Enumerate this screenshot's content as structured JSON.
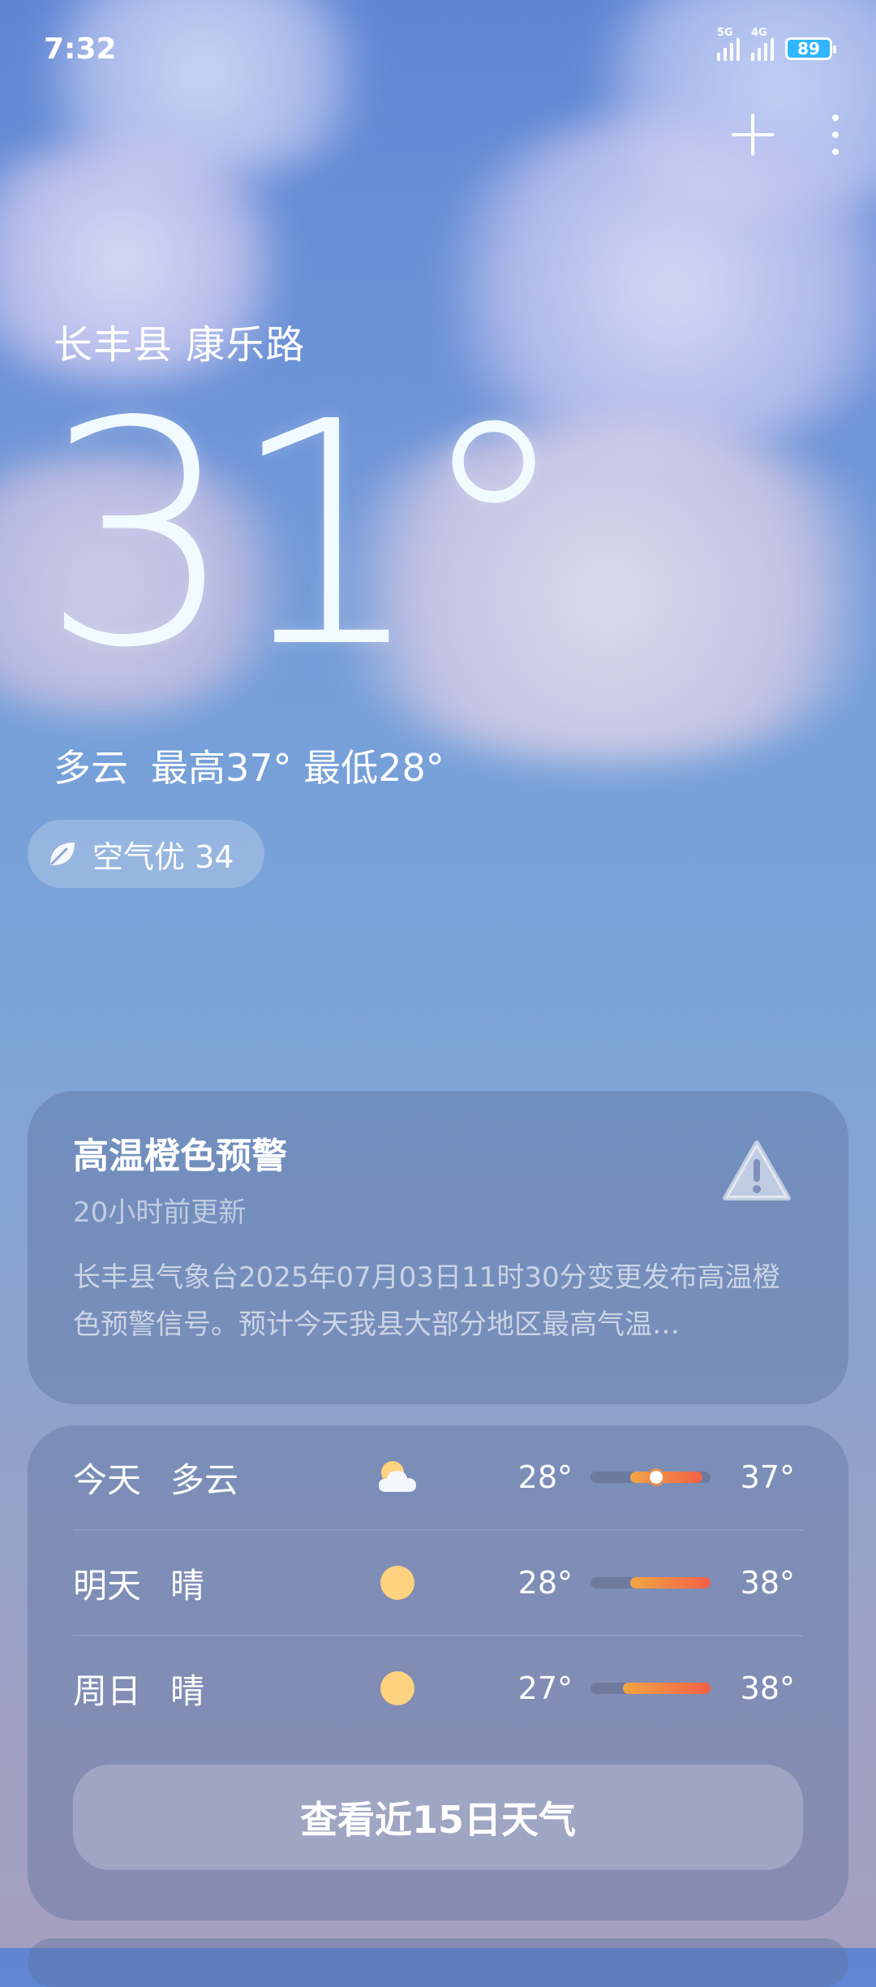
{
  "status_bar": {
    "time": "7:32",
    "net1": "5G",
    "net2": "4G",
    "battery": "89"
  },
  "header": {
    "location": "长丰县 康乐路"
  },
  "current": {
    "temperature": "31°",
    "condition": "多云",
    "high": "最高37°",
    "low": "最低28°",
    "aqi": "空气优 34"
  },
  "alert": {
    "title": "高温橙色预警",
    "updated": "20小时前更新",
    "description": "长丰县气象台2025年07月03日11时30分变更发布高温橙色预警信号。预计今天我县大部分地区最高气温…"
  },
  "forecast": {
    "days": [
      {
        "day": "今天",
        "condition": "多云",
        "icon": "partly-cloudy-icon",
        "low": "28°",
        "high": "37°",
        "bar_start": 0.33,
        "bar_end": 0.93,
        "current": 0.55
      },
      {
        "day": "明天",
        "condition": "晴",
        "icon": "sun-icon",
        "low": "28°",
        "high": "38°",
        "bar_start": 0.33,
        "bar_end": 1.0
      },
      {
        "day": "周日",
        "condition": "晴",
        "icon": "sun-icon",
        "low": "27°",
        "high": "38°",
        "bar_start": 0.27,
        "bar_end": 1.0
      }
    ],
    "button_label": "查看近15日天气"
  },
  "colors": {
    "accent_orange": "#f16046",
    "accent_yellow": "#f3a545",
    "battery": "#2fb6ff"
  }
}
